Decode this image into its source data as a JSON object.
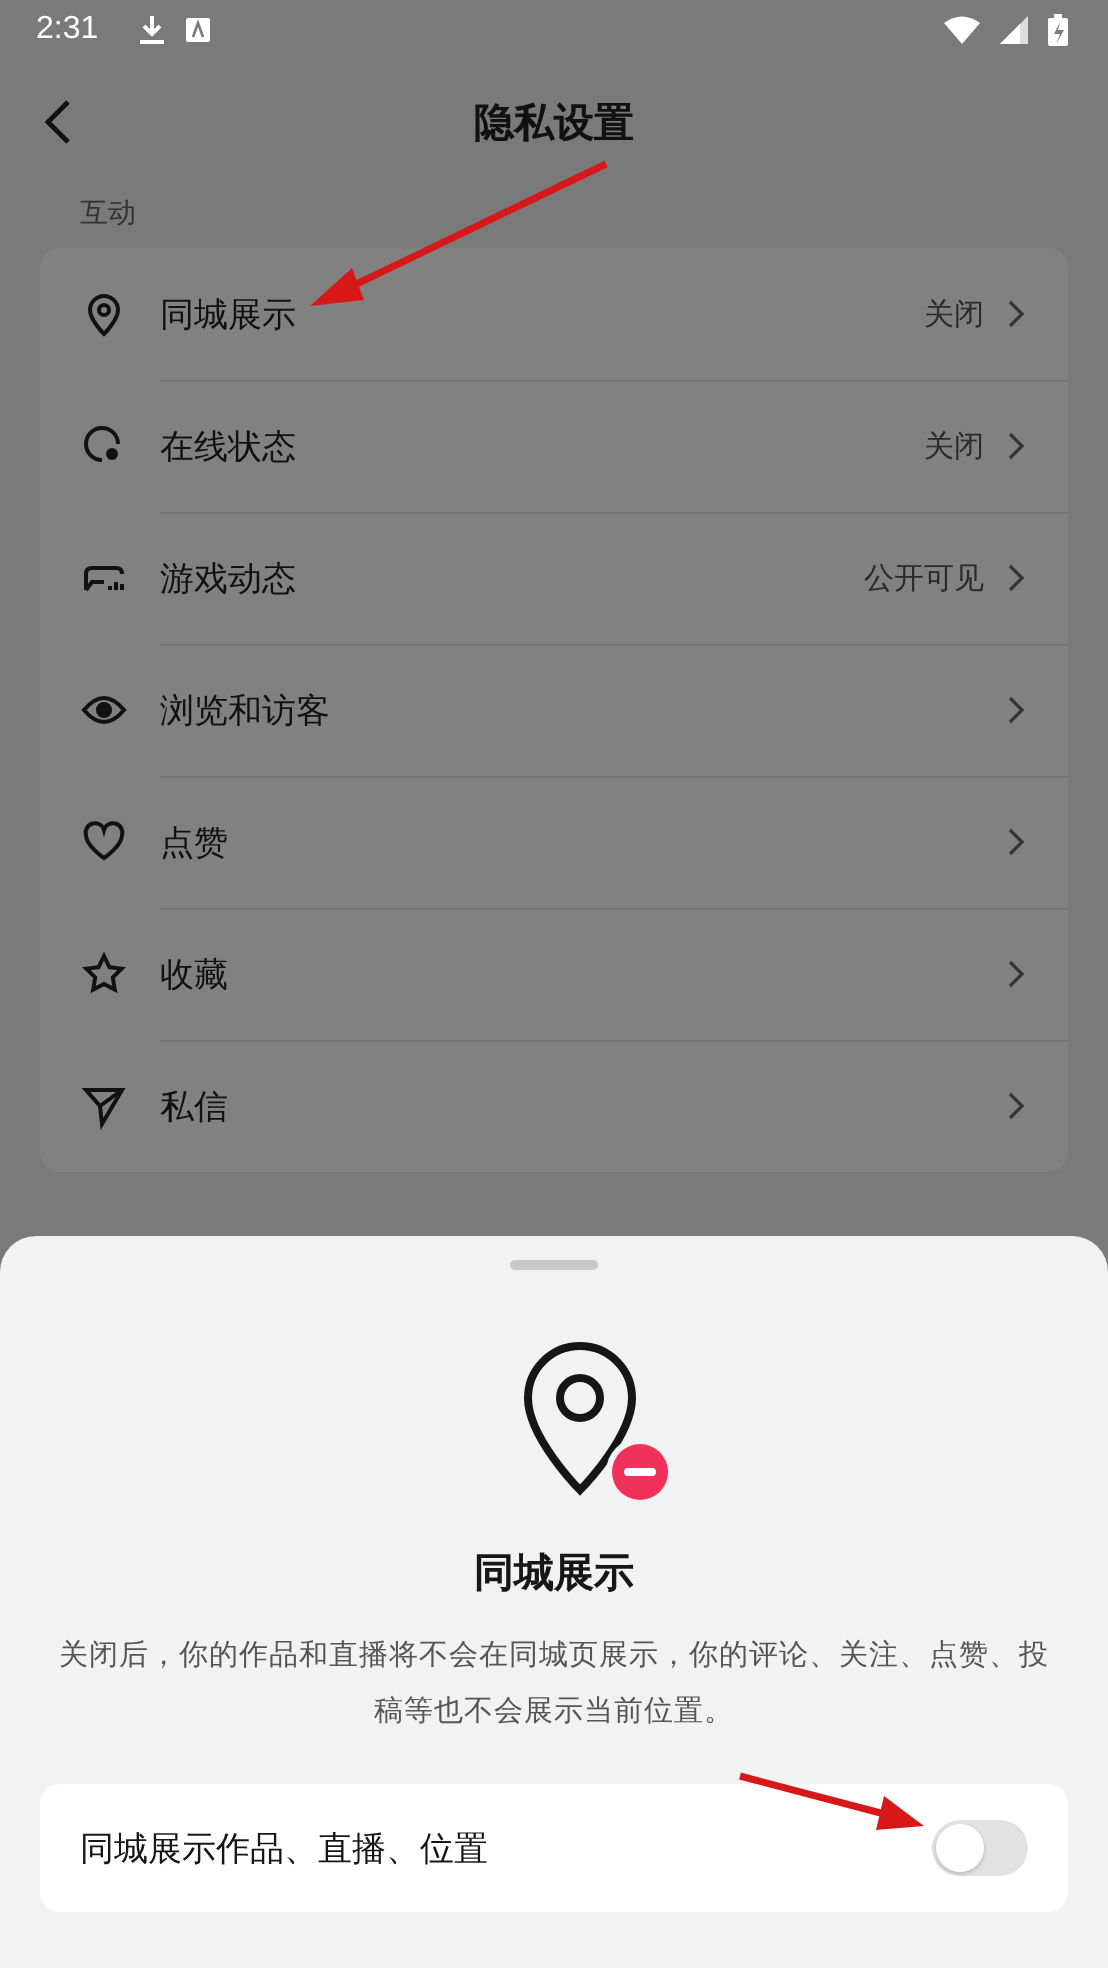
{
  "status_bar": {
    "time": "2:31"
  },
  "header": {
    "title": "隐私设置"
  },
  "section": {
    "label": "互动"
  },
  "items": [
    {
      "label": "同城展示",
      "value": "关闭"
    },
    {
      "label": "在线状态",
      "value": "关闭"
    },
    {
      "label": "游戏动态",
      "value": "公开可见"
    },
    {
      "label": "浏览和访客"
    },
    {
      "label": "点赞"
    },
    {
      "label": "收藏"
    },
    {
      "label": "私信"
    }
  ],
  "sheet": {
    "title": "同城展示",
    "description": "关闭后，你的作品和直播将不会在同城页展示，你的评论、关注、点赞、投稿等也不会展示当前位置。",
    "option": {
      "label": "同城展示作品、直播、位置",
      "on": false
    }
  }
}
